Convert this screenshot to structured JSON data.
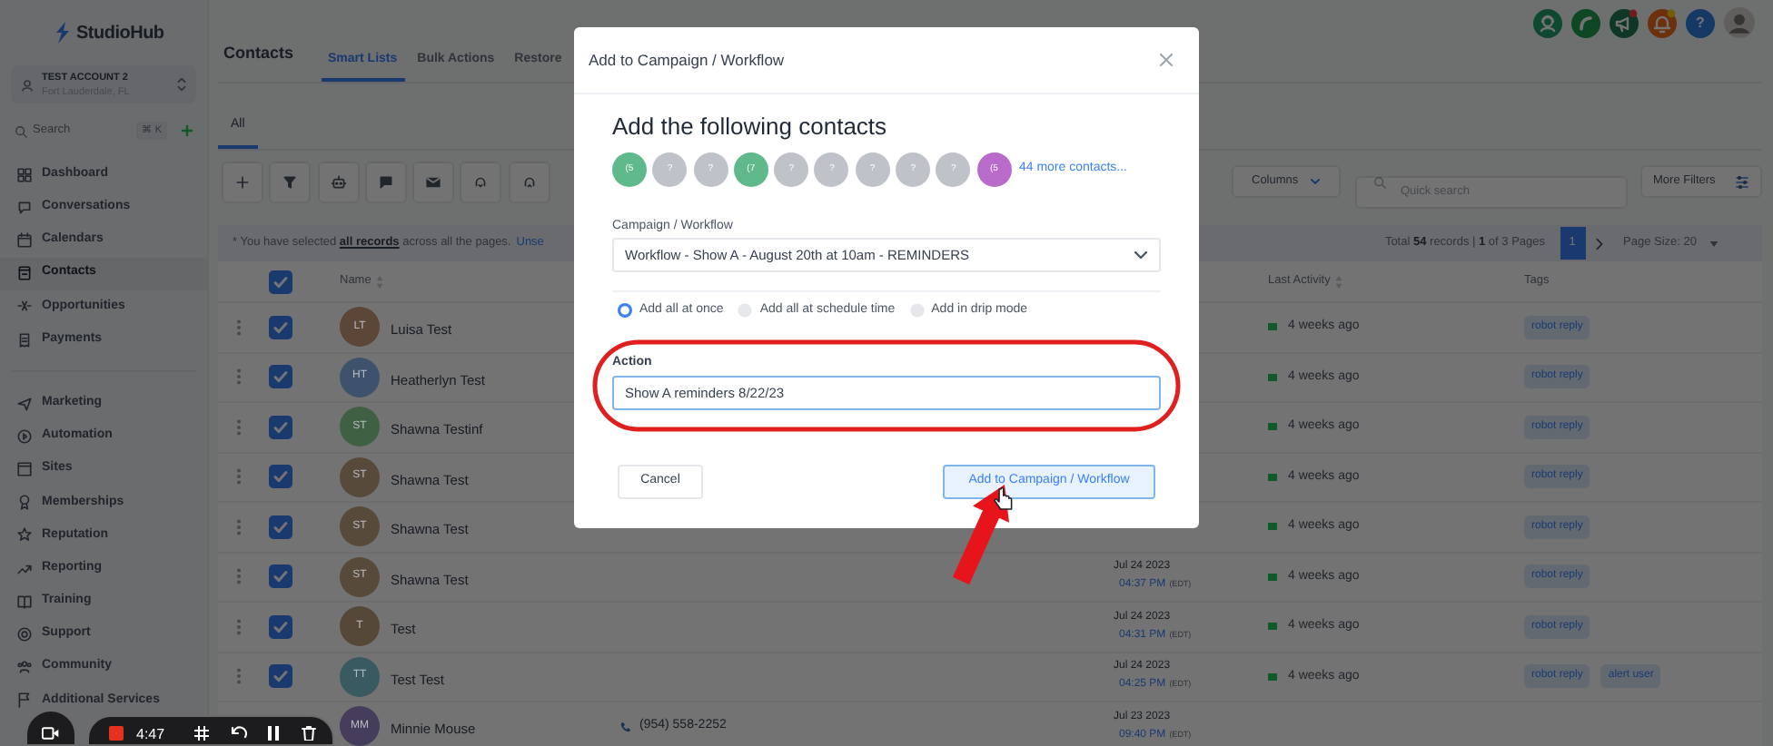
{
  "sidebar": {
    "logo": "StudioHub",
    "account": {
      "name": "TEST ACCOUNT 2",
      "location": "Fort Lauderdale, FL"
    },
    "search": {
      "placeholder": "Search",
      "shortcut": "⌘ K"
    },
    "sections": [
      {
        "items": [
          {
            "label": "Dashboard",
            "selected": false
          },
          {
            "label": "Conversations",
            "selected": false
          },
          {
            "label": "Calendars",
            "selected": false
          },
          {
            "label": "Contacts",
            "selected": true
          },
          {
            "label": "Opportunities",
            "selected": false
          },
          {
            "label": "Payments",
            "selected": false
          }
        ]
      },
      {
        "items": [
          {
            "label": "Marketing",
            "selected": false
          },
          {
            "label": "Automation",
            "selected": false
          },
          {
            "label": "Sites",
            "selected": false
          },
          {
            "label": "Memberships",
            "selected": false
          },
          {
            "label": "Reputation",
            "selected": false
          },
          {
            "label": "Reporting",
            "selected": false
          },
          {
            "label": "Training",
            "selected": false
          },
          {
            "label": "Support",
            "selected": false
          },
          {
            "label": "Community",
            "selected": false
          },
          {
            "label": "Additional Services",
            "selected": false
          }
        ]
      }
    ]
  },
  "header": {
    "title": "Contacts",
    "tabs": [
      {
        "label": "Smart Lists",
        "selected": true
      },
      {
        "label": "Bulk Actions",
        "selected": false
      },
      {
        "label": "Restore",
        "selected": false
      }
    ],
    "help_label": "?"
  },
  "views": [
    {
      "label": "All",
      "selected": true
    }
  ],
  "toolbar": {
    "columns": "Columns",
    "search_placeholder": "Quick search",
    "more_filters": "More Filters"
  },
  "selection": {
    "notice": "* You have selected **all records** across all the pages.",
    "link": "Unse"
  },
  "pagination": {
    "summary": "Total **54** records | **1** of 3 Pages",
    "pages": [
      {
        "label": "1",
        "selected": true
      }
    ],
    "page_size": "Page Size: 20"
  },
  "table": {
    "all_checked": true,
    "columns": [
      {
        "label": "Name",
        "sortable": true
      },
      {
        "label": "Last Activity",
        "sortable": true
      },
      {
        "label": "Tags",
        "sortable": false
      }
    ],
    "rows": [
      {
        "initials": "LT",
        "name": "Luisa Test",
        "color": "#5b4638",
        "checked": true,
        "last_activity": "4 weeks ago",
        "tags": [
          "robot reply"
        ]
      },
      {
        "initials": "HT",
        "name": "Heatherlyn Test",
        "color": "#3e526d",
        "checked": true,
        "last_activity": "4 weeks ago",
        "tags": [
          "robot reply"
        ]
      },
      {
        "initials": "ST",
        "name": "Shawna Testinf",
        "color": "#3f6043",
        "checked": true,
        "last_activity": "4 weeks ago",
        "tags": [
          "robot reply"
        ]
      },
      {
        "initials": "ST",
        "name": "Shawna Test",
        "color": "#584a3a",
        "checked": true,
        "last_activity": "4 weeks ago",
        "tags": [
          "robot reply"
        ]
      },
      {
        "initials": "ST",
        "name": "Shawna Test",
        "color": "#584a3a",
        "checked": true,
        "last_activity": "4 weeks ago",
        "tags": [
          "robot reply"
        ]
      },
      {
        "initials": "ST",
        "name": "Shawna Test",
        "color": "#584a3a",
        "checked": true,
        "date": "Jul 24 2023",
        "time": "04:37 PM",
        "tz": "(EDT)",
        "last_activity": "4 weeks ago",
        "tags": [
          "robot reply"
        ]
      },
      {
        "initials": "T",
        "name": "Test",
        "color": "#564838",
        "checked": true,
        "date": "Jul 24 2023",
        "time": "04:31 PM",
        "tz": "(EDT)",
        "last_activity": "4 weeks ago",
        "tags": [
          "robot reply"
        ]
      },
      {
        "initials": "TT",
        "name": "Test Test",
        "color": "#3a5a62",
        "checked": true,
        "date": "Jul 24 2023",
        "time": "04:25 PM",
        "tz": "(EDT)",
        "last_activity": "4 weeks ago",
        "tags": [
          "robot reply",
          "alert user"
        ]
      },
      {
        "initials": "MM",
        "name": "Minnie Mouse",
        "color": "#463c5c",
        "phone": "(954) 558-2252",
        "date": "Jul 23 2023",
        "time": "09:40 PM",
        "tz": "(EDT)"
      }
    ]
  },
  "modal": {
    "title": "Add to Campaign / Workflow",
    "heading": "Add the following contacts",
    "contacts": [
      {
        "label": "(5",
        "color": "#5fb98a"
      },
      {
        "label": "?",
        "color": "#bfc3c9"
      },
      {
        "label": "?",
        "color": "#bfc3c9"
      },
      {
        "label": "(7",
        "color": "#5fb98a"
      },
      {
        "label": "?",
        "color": "#bfc3c9"
      },
      {
        "label": "?",
        "color": "#bfc3c9"
      },
      {
        "label": "?",
        "color": "#bfc3c9"
      },
      {
        "label": "?",
        "color": "#bfc3c9"
      },
      {
        "label": "?",
        "color": "#bfc3c9"
      },
      {
        "label": "(5",
        "color": "#b86bc9"
      }
    ],
    "more_link": "44 more contacts...",
    "workflow": {
      "label": "Campaign / Workflow",
      "value": "Workflow - Show A - August 20th at 10am - REMINDERS"
    },
    "modes": [
      {
        "label": "Add all at once",
        "selected": true
      },
      {
        "label": "Add all at schedule time",
        "selected": false
      },
      {
        "label": "Add in drip mode",
        "selected": false
      }
    ],
    "action": {
      "label": "Action",
      "value": "Show A reminders 8/22/23"
    },
    "buttons": [
      {
        "label": "Cancel",
        "kind": "secondary"
      },
      {
        "label": "Add to Campaign / Workflow",
        "kind": "primary"
      }
    ]
  },
  "recorder": {
    "time": "4:47"
  }
}
